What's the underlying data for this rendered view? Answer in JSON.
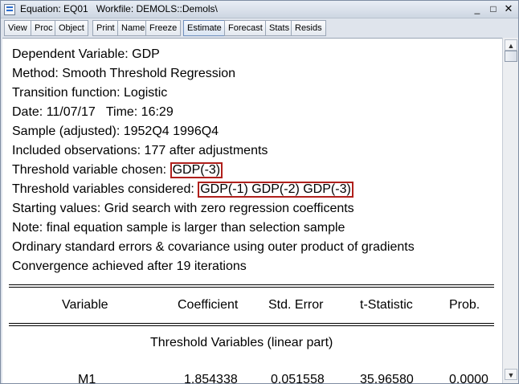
{
  "window": {
    "title": "Equation: EQ01   Workfile: DEMOLS::Demols\\",
    "buttons": {
      "minimize": "_",
      "maximize": "□",
      "close": "✕"
    }
  },
  "toolbar": {
    "view": "View",
    "proc": "Proc",
    "object": "Object",
    "print": "Print",
    "name": "Name",
    "freeze": "Freeze",
    "estimate": "Estimate",
    "forecast": "Forecast",
    "stats": "Stats",
    "resids": "Resids"
  },
  "output": {
    "dependent": "Dependent Variable: GDP",
    "method": "Method: Smooth Threshold Regression",
    "transition": "Transition function: Logistic",
    "date": "Date: 11/07/17   Time: 16:29",
    "sample": "Sample (adjusted): 1952Q4 1996Q4",
    "observations": "Included observations: 177 after adjustments",
    "threshold_chosen_label": "Threshold variable chosen: ",
    "threshold_chosen_value": "GDP(-3)",
    "threshold_considered_label": "Threshold variables considered: ",
    "threshold_considered_value": "GDP(-1) GDP(-2) GDP(-3)",
    "starting_values": "Starting values: Grid search with zero regression coefficents",
    "note": "Note: final equation sample is larger than selection sample",
    "std_errors": "Ordinary standard errors & covariance using outer product of gradients",
    "convergence": "Convergence achieved after 19 iterations"
  },
  "table": {
    "headers": {
      "variable": "Variable",
      "coefficient": "Coefficient",
      "std_error": "Std. Error",
      "t_statistic": "t-Statistic",
      "prob": "Prob."
    },
    "section_title": "Threshold Variables (linear part)",
    "rows": [
      {
        "variable": "M1",
        "coefficient": "1.854338",
        "std_error": "0.051558",
        "t_statistic": "35.96580",
        "prob": "0.0000"
      }
    ]
  },
  "colors": {
    "highlight_border": "#b0201c",
    "titlebar": "#cdd6e2"
  }
}
